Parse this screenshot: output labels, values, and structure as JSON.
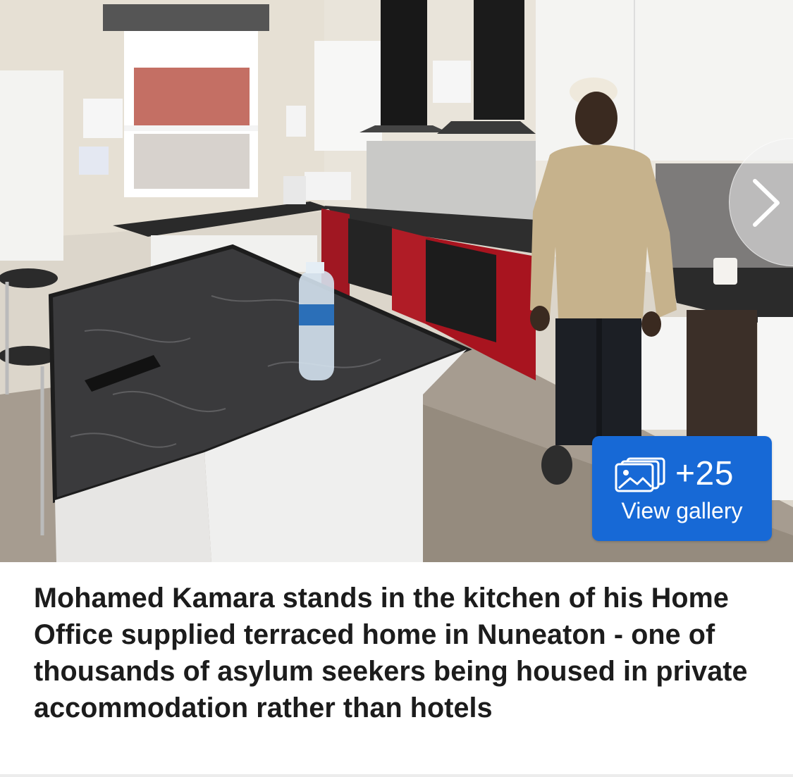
{
  "article_image": {
    "alt": "Kitchen with island counter, red cabinets and man in hoodie"
  },
  "gallery": {
    "count_label": "+25",
    "view_label": "View gallery",
    "icon": "images-stack-icon"
  },
  "carousel": {
    "next_icon": "chevron-right-icon"
  },
  "caption": {
    "text": "Mohamed Kamara stands in the kitchen of his Home Office supplied terraced home in Nuneaton - one of thousands of asylum seekers being housed in private accommodation rather than hotels"
  },
  "colors": {
    "accent": "#1769d6",
    "caption_text": "#1c1c1c"
  }
}
